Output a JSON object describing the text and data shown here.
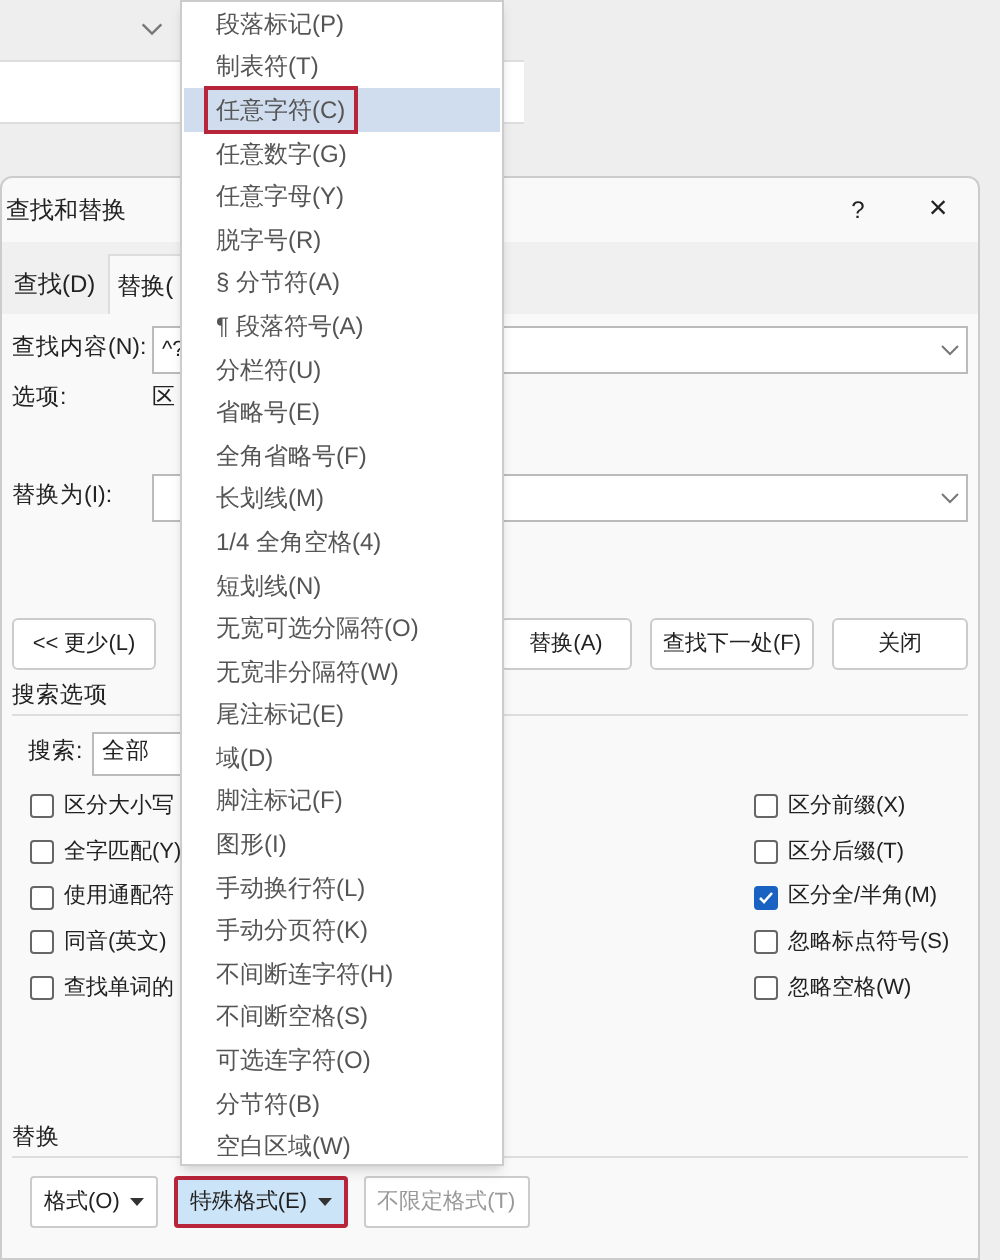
{
  "dialog": {
    "title": "查找和替换",
    "help": "?",
    "close": "×"
  },
  "tabs": [
    {
      "label": "查找(D)",
      "selected": false
    },
    {
      "label": "替换(",
      "selected": true
    }
  ],
  "find": {
    "label": "查找内容(N):",
    "value": "^?"
  },
  "options": {
    "label": "选项:",
    "value": "区"
  },
  "replace": {
    "label": "替换为(I):"
  },
  "more_button": "<< 更少(L)",
  "action_buttons": [
    "替换(A)",
    "查找下一处(F)",
    "关闭"
  ],
  "search_options": {
    "title": "搜索选项",
    "search_label": "搜索:",
    "search_value": "全部"
  },
  "left_checks": [
    {
      "label": "区分大小写",
      "checked": false
    },
    {
      "label": "全字匹配(Y)",
      "checked": false
    },
    {
      "label": "使用通配符",
      "checked": false
    },
    {
      "label": "同音(英文)",
      "checked": false
    },
    {
      "label": "查找单词的",
      "checked": false
    }
  ],
  "right_checks": [
    {
      "label": "区分前缀(X)",
      "checked": false
    },
    {
      "label": "区分后缀(T)",
      "checked": false
    },
    {
      "label": "区分全/半角(M)",
      "checked": true
    },
    {
      "label": "忽略标点符号(S)",
      "checked": false
    },
    {
      "label": "忽略空格(W)",
      "checked": false
    }
  ],
  "replace_section": "替换",
  "bottom_buttons": [
    {
      "label": "格式(O)",
      "kind": "dropdown",
      "pressed": false,
      "disabled": false
    },
    {
      "label": "特殊格式(E)",
      "kind": "dropdown",
      "pressed": true,
      "disabled": false
    },
    {
      "label": "不限定格式(T)",
      "kind": "plain",
      "pressed": false,
      "disabled": true
    }
  ],
  "menu": [
    {
      "label": "段落标记(P)",
      "selected": false
    },
    {
      "label": "制表符(T)",
      "selected": false
    },
    {
      "label": "任意字符(C)",
      "selected": true
    },
    {
      "label": "任意数字(G)",
      "selected": false
    },
    {
      "label": "任意字母(Y)",
      "selected": false
    },
    {
      "label": "脱字号(R)",
      "selected": false
    },
    {
      "label": "§ 分节符(A)",
      "selected": false
    },
    {
      "label": "¶ 段落符号(A)",
      "selected": false
    },
    {
      "label": "分栏符(U)",
      "selected": false
    },
    {
      "label": "省略号(E)",
      "selected": false
    },
    {
      "label": "全角省略号(F)",
      "selected": false
    },
    {
      "label": "长划线(M)",
      "selected": false
    },
    {
      "label": "1/4 全角空格(4)",
      "selected": false
    },
    {
      "label": "短划线(N)",
      "selected": false
    },
    {
      "label": "无宽可选分隔符(O)",
      "selected": false
    },
    {
      "label": "无宽非分隔符(W)",
      "selected": false
    },
    {
      "label": "尾注标记(E)",
      "selected": false
    },
    {
      "label": "域(D)",
      "selected": false
    },
    {
      "label": "脚注标记(F)",
      "selected": false
    },
    {
      "label": "图形(I)",
      "selected": false
    },
    {
      "label": "手动换行符(L)",
      "selected": false
    },
    {
      "label": "手动分页符(K)",
      "selected": false
    },
    {
      "label": "不间断连字符(H)",
      "selected": false
    },
    {
      "label": "不间断空格(S)",
      "selected": false
    },
    {
      "label": "可选连字符(O)",
      "selected": false
    },
    {
      "label": "分节符(B)",
      "selected": false
    },
    {
      "label": "空白区域(W)",
      "selected": false
    }
  ]
}
